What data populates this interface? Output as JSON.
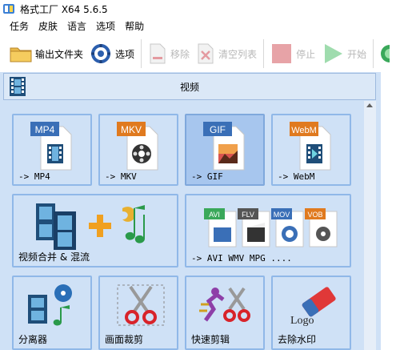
{
  "window": {
    "title": "格式工厂 X64 5.6.5"
  },
  "menu": {
    "items": [
      "任务",
      "皮肤",
      "语言",
      "选项",
      "帮助"
    ]
  },
  "toolbar": {
    "output_folder": "输出文件夹",
    "options": "选项",
    "remove": "移除",
    "clear_list": "清空列表",
    "stop": "停止",
    "start": "开始"
  },
  "section": {
    "label": "视频"
  },
  "tiles": {
    "mp4": {
      "badge": "MP4",
      "label": "-> MP4"
    },
    "mkv": {
      "badge": "MKV",
      "label": "-> MKV"
    },
    "gif": {
      "badge": "GIF",
      "label": "-> GIF"
    },
    "webm": {
      "badge": "WebM",
      "label": "-> WebM"
    },
    "merge": {
      "label": "视频合并 & 混流"
    },
    "avi": {
      "badges": [
        "AVI",
        "FLV",
        "MOV",
        "VOB"
      ],
      "label": "-> AVI WMV MPG ...."
    },
    "splitter": {
      "label": "分离器"
    },
    "crop": {
      "label": "画面裁剪"
    },
    "fastcut": {
      "label": "快速剪辑"
    },
    "watermark": {
      "badge": "Logo",
      "label": "去除水印"
    }
  },
  "colors": {
    "panel": "#cfe1f6",
    "tile_border": "#90b8e8",
    "selected": "#a7c6ee",
    "badge_blue": "#3a6fb7",
    "badge_orange": "#e07a1f"
  }
}
